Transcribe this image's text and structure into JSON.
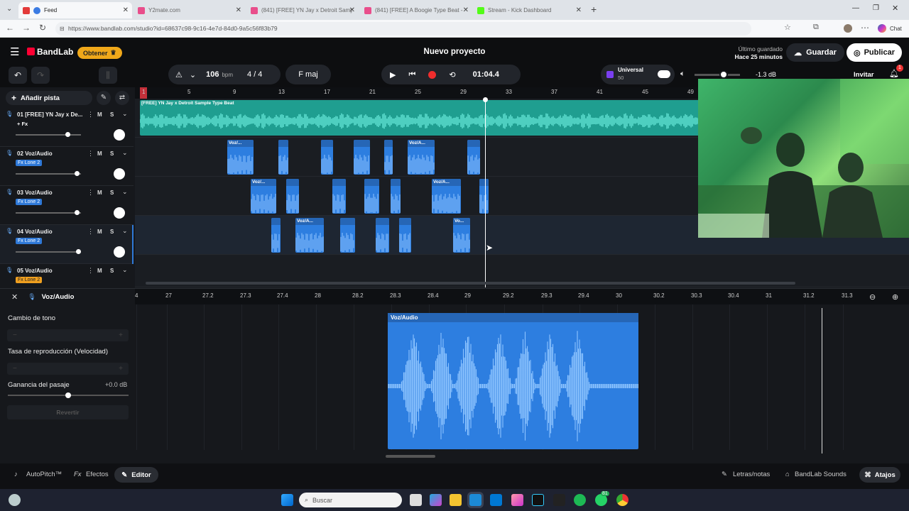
{
  "browser": {
    "tabs": [
      {
        "label": "Feed",
        "active": true,
        "color": "#e33b3b"
      },
      {
        "label": "Y2mate.com",
        "color": "#e94e8b"
      },
      {
        "label": "(841) [FREE] YN Jay x Detroit Sampl",
        "color": "#e94e8b"
      },
      {
        "label": "(841) [FREE] A Boogie Type Beat -",
        "color": "#e94e8b"
      },
      {
        "label": "Stream - Kick Dashboard",
        "color": "#53fc18"
      }
    ],
    "url": "https://www.bandlab.com/studio?id=68637c98-9c16-4e7d-84d0-9a5c56f83b79",
    "chat_label": "Chat"
  },
  "header": {
    "brand": "BandLab",
    "obtener": "Obtener",
    "title": "Nuevo proyecto",
    "saved_line1": "Último guardado",
    "saved_line2": "Hace 25 minutos",
    "save": "Guardar",
    "publish": "Publicar"
  },
  "controls": {
    "bpm": "106",
    "bpm_unit": "bpm",
    "time_sig": "4 / 4",
    "key": "F maj",
    "time": "01:04.4",
    "universal_label": "Universal",
    "universal_value": "50",
    "volume": "-1.3 dB",
    "invite": "Invitar",
    "notif_count": "1"
  },
  "tracklist": {
    "add_track": "Añadir pista",
    "tracks": [
      {
        "name": "01  [FREE] YN Jay x De...",
        "fx": "+ Fx",
        "fx_style": "plain",
        "vol": 0.8
      },
      {
        "name": "02  Voz/Audio",
        "fx": "Fx Lone 2",
        "fx_style": "blue",
        "vol": 0.95
      },
      {
        "name": "03  Voz/Audio",
        "fx": "Fx Lone 2",
        "fx_style": "blue",
        "vol": 0.95
      },
      {
        "name": "04  Voz/Audio",
        "fx": "Fx Lone 2",
        "fx_style": "blue",
        "vol": 0.97
      },
      {
        "name": "05  Voz/Audio",
        "fx": "Fx Lone 2",
        "fx_style": "orange",
        "vol": 0.95
      }
    ],
    "m": "M",
    "s": "S"
  },
  "ruler": [
    "1",
    "5",
    "9",
    "13",
    "17",
    "21",
    "25",
    "29",
    "33",
    "37",
    "41",
    "45",
    "49"
  ],
  "beat_clip_label": "[FREE] YN Jay x Detroit Sample Type Beat",
  "clip_labels": {
    "t2a": "Voz/...",
    "t2b": "Voz/A...",
    "t3a": "Voz/...",
    "t3b": "Voz/A...",
    "t4a": "Voz/A...",
    "t4b": "Vo..."
  },
  "editor": {
    "track_name": "Voz/Audio",
    "ruler": [
      "4",
      "27",
      "27.2",
      "27.3",
      "27.4",
      "28",
      "28.2",
      "28.3",
      "28.4",
      "29",
      "29.2",
      "29.3",
      "29.4",
      "30",
      "30.2",
      "30.3",
      "30.4",
      "31",
      "31.2",
      "31.3"
    ],
    "pitch_label": "Cambio de tono",
    "speed_label": "Tasa de reproducción (Velocidad)",
    "gain_label": "Ganancia del pasaje",
    "gain_value": "+0.0 dB",
    "revert": "Revertir",
    "clip_label": "Voz/Audio"
  },
  "bottom": {
    "autopitch": "AutoPitch™",
    "effects": "Efectos",
    "editor": "Editor",
    "lyrics": "Letras/notas",
    "sounds": "BandLab Sounds",
    "shortcuts": "Atajos"
  },
  "taskbar": {
    "search_placeholder": "Buscar",
    "whatsapp_badge": "81"
  }
}
